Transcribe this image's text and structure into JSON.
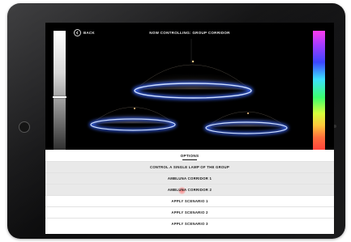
{
  "screen": {
    "back_label": "BACK",
    "title": "NOW CONTROLLING: GROUP CORRIDOR"
  },
  "sliders": {
    "intensity_level": 0.45,
    "hue_colors": [
      "#ff3cf0",
      "#3c46ff",
      "#3ce1ff",
      "#3cff6e",
      "#ffc83c",
      "#ff3c3c"
    ]
  },
  "options": {
    "title": "OPTIONS",
    "items": [
      {
        "label": "CONTROL A SINGLE LAMP OF THE GROUP",
        "style": "shaded"
      },
      {
        "label": "AMBLUNA CORRIDOR 1",
        "style": "shaded"
      },
      {
        "label": "AMBLUNA CORRIDOR 2",
        "style": "shaded"
      },
      {
        "label": "APPLY SCENARIO 1",
        "style": "white"
      },
      {
        "label": "APPLY SCENARIO 2",
        "style": "white"
      },
      {
        "label": "APPLY SCENARIO 3",
        "style": "white"
      }
    ]
  },
  "colors": {
    "lamp_glow": "#4d7dff",
    "screen_bg": "#000000"
  }
}
